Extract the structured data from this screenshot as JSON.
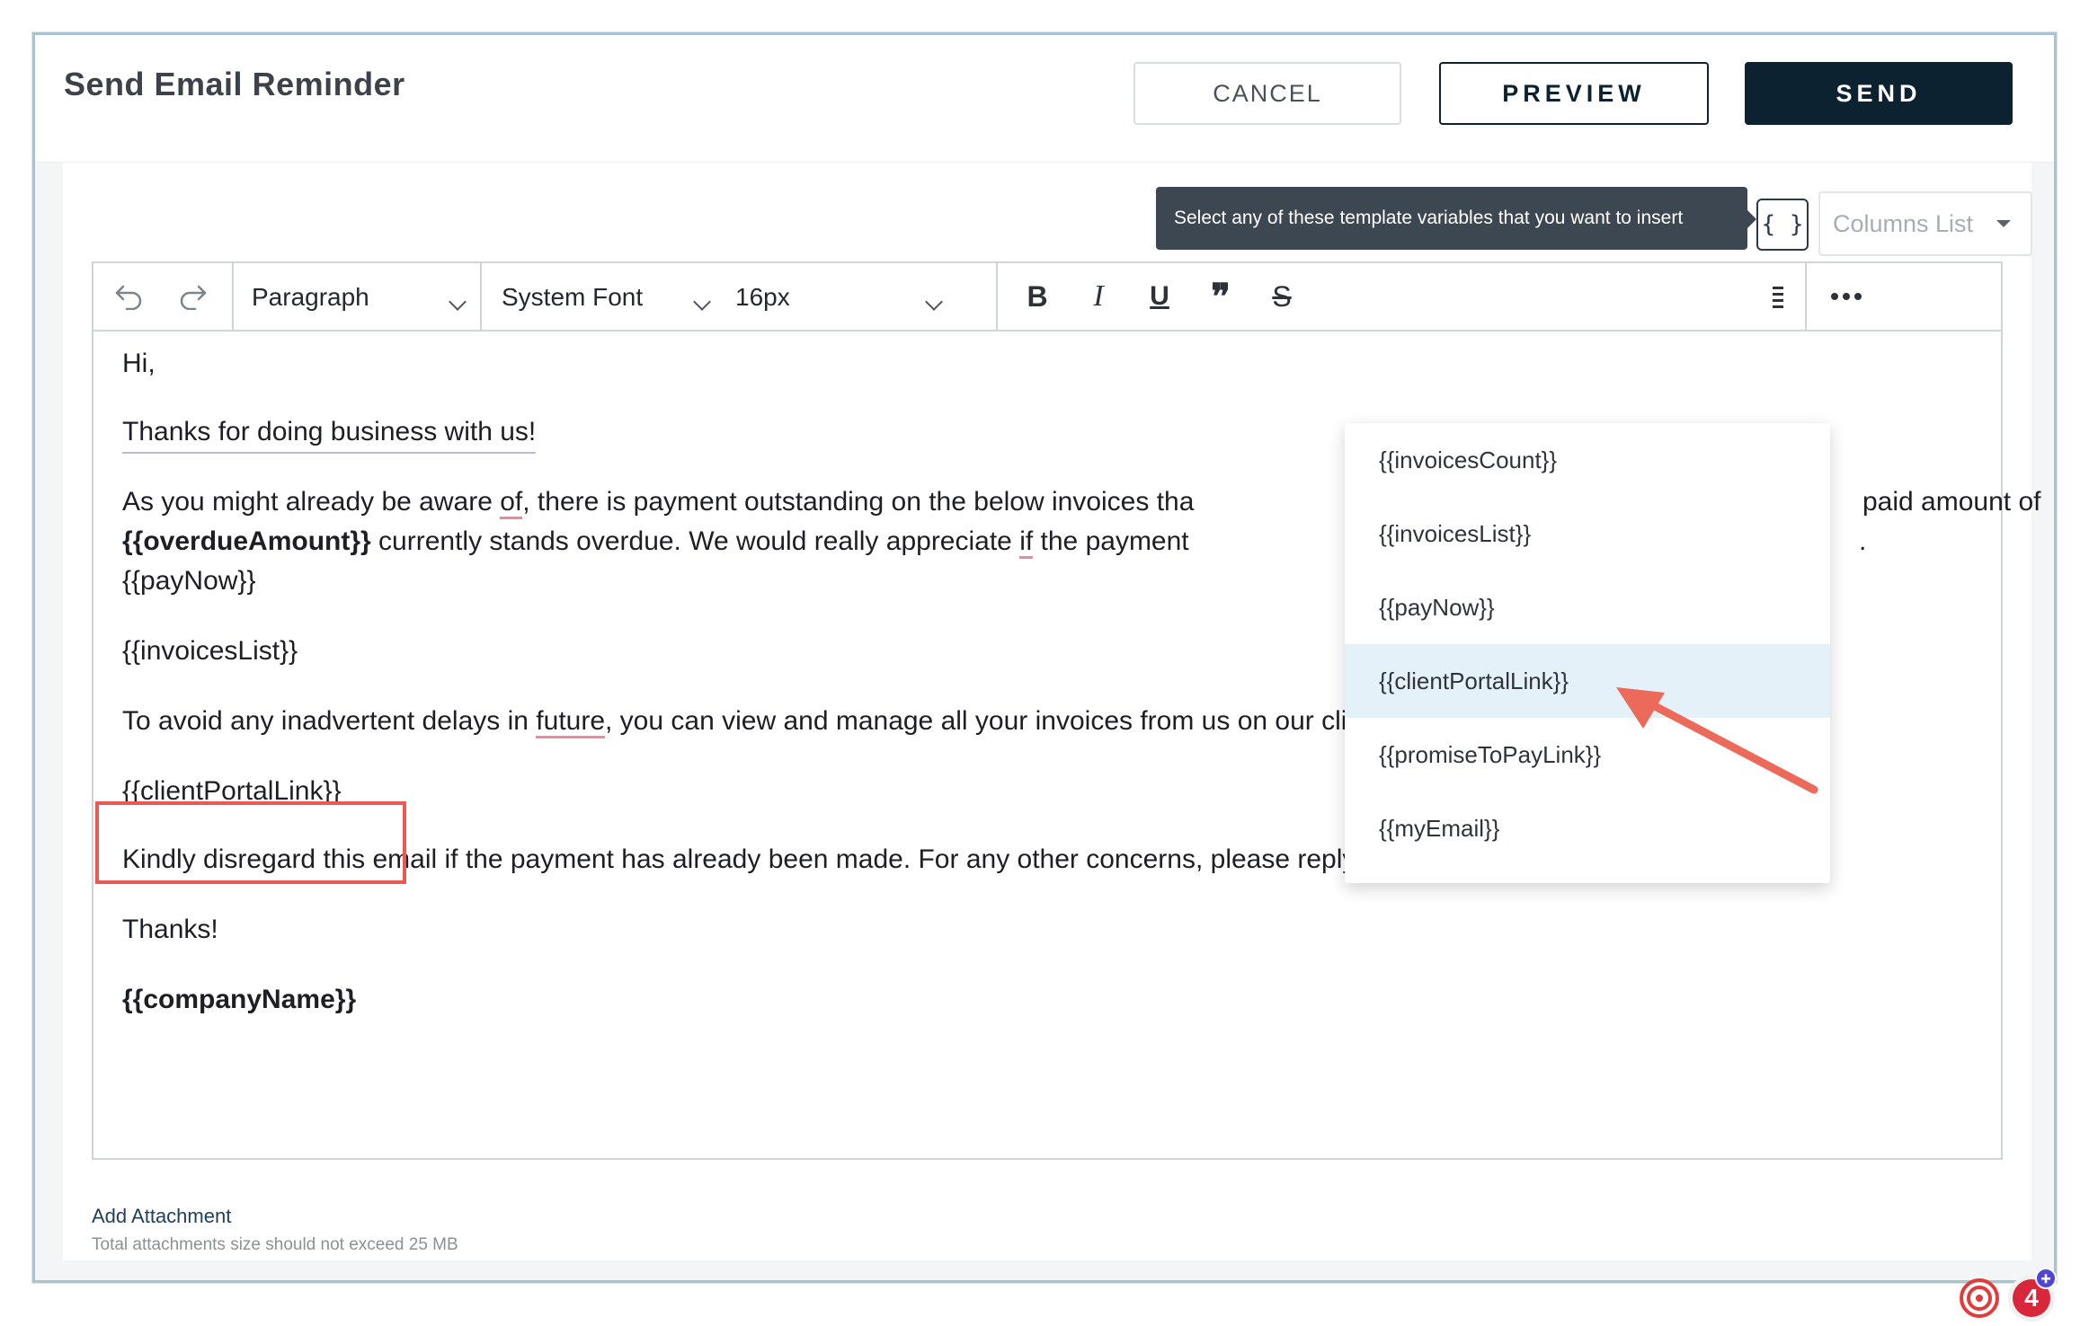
{
  "header": {
    "title": "Send Email Reminder",
    "cancel_label": "CANCEL",
    "preview_label": "PREVIEW",
    "send_label": "SEND"
  },
  "template_tools": {
    "tooltip": "Select any of these template variables that you want to insert",
    "variable_button_label": "{ }",
    "columns_placeholder": "Columns List"
  },
  "toolbar": {
    "block_format": "Paragraph",
    "font_family": "System Font",
    "font_size": "16px"
  },
  "email_body": {
    "greeting": "Hi,",
    "thanks_line": "Thanks for doing business with us!",
    "p3_part1": "As you might already be aware ",
    "p3_of": "of",
    "p3_part2": ", there is payment outstanding on the below invoices tha",
    "p3_right": "paid amount of",
    "p3_line2_var": "{{overdueAmount}}",
    "p3_line2_text1": " currently stands overdue. We would really appreciate ",
    "p3_if": "if",
    "p3_line2_text2": " the payment",
    "p3_line2_tail": ".",
    "pay_now": "{{payNow}}",
    "invoices_list": "{{invoicesList}}",
    "portal_line_part1": "To avoid any inadvertent delays in ",
    "portal_line_future": "future",
    "portal_line_part2": ", you can view and manage all your invoices from us on our client portal at the below link.",
    "client_portal_link": "{{clientPortalLink}}",
    "disregard_line": "Kindly disregard this email if the payment has already been made. For any other concerns, please reply to this email.",
    "thanks": "Thanks!",
    "company_name": "{{companyName}}"
  },
  "variables_dropdown": {
    "items": [
      {
        "label": "{{invoicesCount}}"
      },
      {
        "label": "{{invoicesList}}"
      },
      {
        "label": "{{payNow}}"
      },
      {
        "label": "{{clientPortalLink}}"
      },
      {
        "label": "{{promiseToPayLink}}"
      },
      {
        "label": "{{myEmail}}"
      }
    ],
    "active_index": 3
  },
  "footer": {
    "add_attachment": "Add Attachment",
    "attachment_note": "Total attachments size should not exceed 25 MB"
  },
  "badge": {
    "count": "4"
  },
  "colors": {
    "primary": "#0c2230",
    "highlight_box": "#ea5a55",
    "arrow": "#ec6a5a",
    "dropdown_active": "#e5f1f8"
  }
}
